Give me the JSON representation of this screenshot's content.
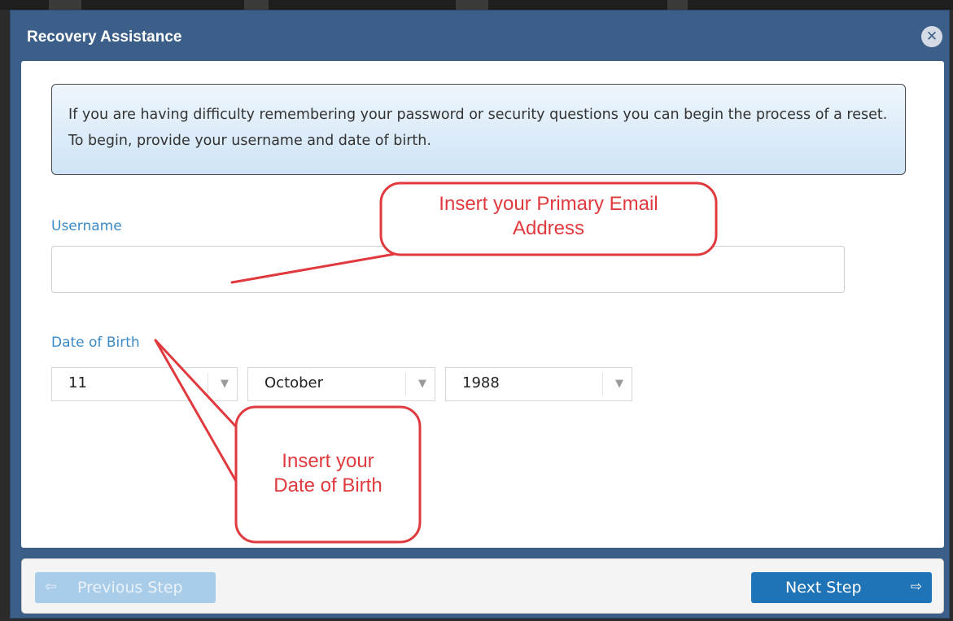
{
  "dialog": {
    "title": "Recovery Assistance",
    "close_icon": "close-icon"
  },
  "info": {
    "message": "If you are having difficulty remembering your password or security questions you can begin the process of a reset. To begin, provide your username and date of birth."
  },
  "form": {
    "username": {
      "label": "Username",
      "value": ""
    },
    "dob": {
      "label": "Date of Birth",
      "day": "11",
      "month": "October",
      "year": "1988"
    }
  },
  "footer": {
    "prev_label": "Previous Step",
    "prev_icon": "arrow-left-icon",
    "next_label": "Next Step",
    "next_icon": "arrow-right-icon"
  },
  "annotations": {
    "email_callout_line1": "Insert your Primary Email",
    "email_callout_line2": "Address",
    "dob_callout_line1": "Insert your",
    "dob_callout_line2": "Date of Birth",
    "color": "#e0393e"
  },
  "colors": {
    "titlebar": "#3c5f8a",
    "label": "#3c8ac6",
    "next_button": "#1f73b7",
    "prev_button": "#a9cce9"
  }
}
